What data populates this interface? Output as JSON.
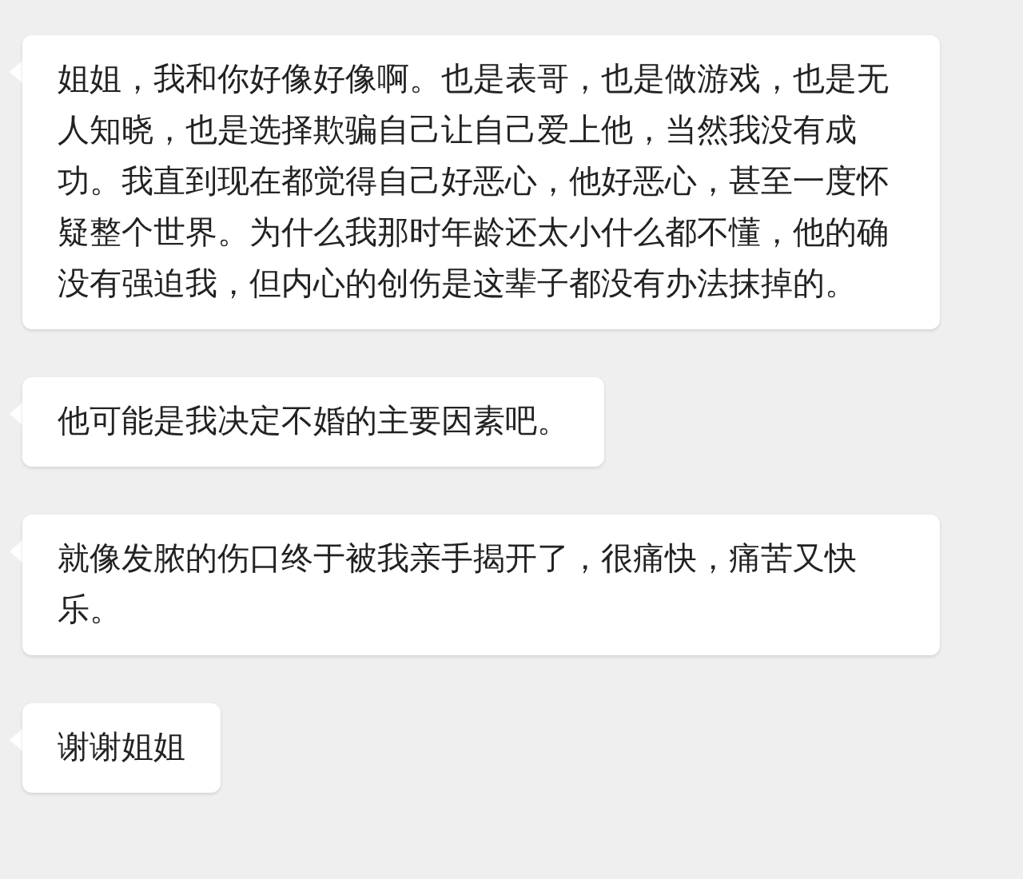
{
  "messages": [
    {
      "text": "姐姐，我和你好像好像啊。也是表哥，也是做游戏，也是无人知晓，也是选择欺骗自己让自己爱上他，当然我没有成功。我直到现在都觉得自己好恶心，他好恶心，甚至一度怀疑整个世界。为什么我那时年龄还太小什么都不懂，他的确没有强迫我，但内心的创伤是这辈子都没有办法抹掉的。"
    },
    {
      "text": "他可能是我决定不婚的主要因素吧。"
    },
    {
      "text": "就像发脓的伤口终于被我亲手揭开了，很痛快，痛苦又快乐。"
    },
    {
      "text": "谢谢姐姐"
    }
  ]
}
